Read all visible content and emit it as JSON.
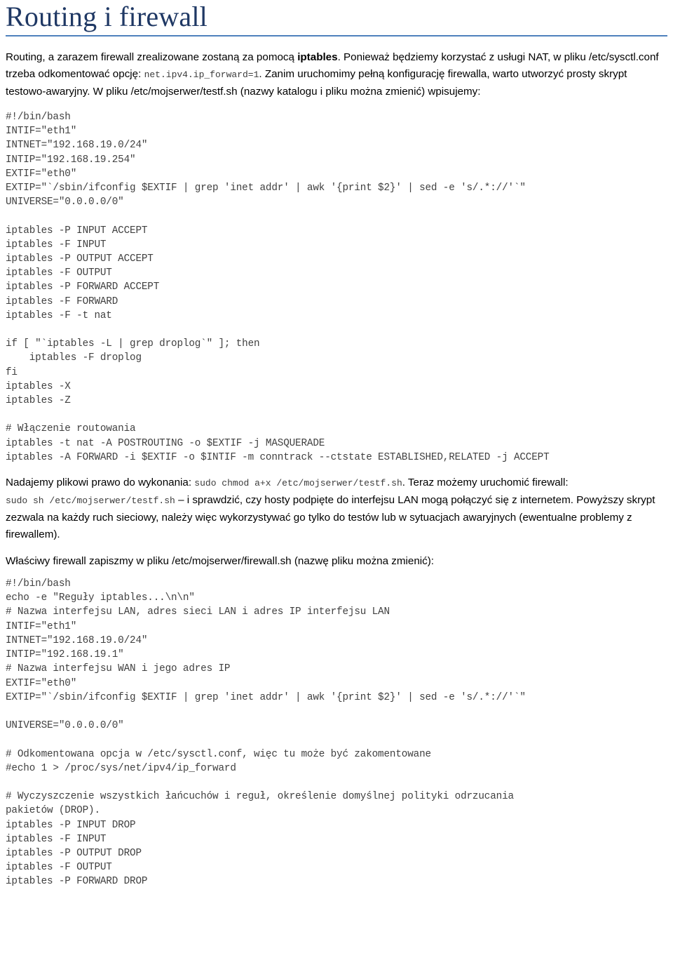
{
  "document": {
    "title": "Routing i firewall",
    "accent_color": "#1F3864",
    "rule_color": "#4F81BD"
  },
  "intro": {
    "part1": "Routing, a zarazem firewall zrealizowane zostaną za pomocą ",
    "bold1": "iptables",
    "part2": ". Ponieważ będziemy korzystać z usługi NAT, w pliku /etc/sysctl.conf trzeba odkomentować opcję: ",
    "code1": "net.ipv4.ip_forward=1",
    "part3": ". Zanim uruchomimy pełną konfigurację firewalla, warto utworzyć prosty skrypt testowo-awaryjny. W pliku /etc/mojserwer/testf.sh (nazwy katalogu i pliku można zmienić) wpisujemy:"
  },
  "code_block_1": "#!/bin/bash\nINTIF=\"eth1\"\nINTNET=\"192.168.19.0/24\"\nINTIP=\"192.168.19.254\"\nEXTIF=\"eth0\"\nEXTIP=\"`/sbin/ifconfig $EXTIF | grep 'inet addr' | awk '{print $2}' | sed -e 's/.*://'`\"\nUNIVERSE=\"0.0.0.0/0\"\n\niptables -P INPUT ACCEPT\niptables -F INPUT\niptables -P OUTPUT ACCEPT\niptables -F OUTPUT\niptables -P FORWARD ACCEPT\niptables -F FORWARD\niptables -F -t nat\n\nif [ \"`iptables -L | grep droplog`\" ]; then\n    iptables -F droplog\nfi\niptables -X\niptables -Z\n\n# Włączenie routowania\niptables -t nat -A POSTROUTING -o $EXTIF -j MASQUERADE\niptables -A FORWARD -i $EXTIF -o $INTIF -m conntrack --ctstate ESTABLISHED,RELATED -j ACCEPT",
  "para_exec": {
    "part1": "Nadajemy plikowi prawo do wykonania: ",
    "code1": "sudo chmod a+x /etc/mojserwer/testf.sh",
    "part2": ". Teraz możemy uruchomić firewall: ",
    "code2": "sudo sh /etc/mojserwer/testf.sh",
    "part3": " – i sprawdzić, czy hosty podpięte do interfejsu LAN mogą połączyć się z internetem. Powyższy skrypt zezwala na każdy ruch sieciowy, należy więc wykorzystywać go tylko do testów lub w sytuacjach awaryjnych (ewentualne problemy z firewallem)."
  },
  "para_firewall_intro": "Właściwy firewall zapiszmy w pliku /etc/mojserwer/firewall.sh (nazwę pliku można zmienić):",
  "code_block_2": "#!/bin/bash\necho -e \"Reguły iptables...\\n\\n\"\n# Nazwa interfejsu LAN, adres sieci LAN i adres IP interfejsu LAN\nINTIF=\"eth1\"\nINTNET=\"192.168.19.0/24\"\nINTIP=\"192.168.19.1\"\n# Nazwa interfejsu WAN i jego adres IP\nEXTIF=\"eth0\"\nEXTIP=\"`/sbin/ifconfig $EXTIF | grep 'inet addr' | awk '{print $2}' | sed -e 's/.*://'`\"\n\nUNIVERSE=\"0.0.0.0/0\"\n\n# Odkomentowana opcja w /etc/sysctl.conf, więc tu może być zakomentowane\n#echo 1 > /proc/sys/net/ipv4/ip_forward\n\n# Wyczyszczenie wszystkich łańcuchów i reguł, określenie domyślnej polityki odrzucania\npakietów (DROP).\niptables -P INPUT DROP\niptables -F INPUT\niptables -P OUTPUT DROP\niptables -F OUTPUT\niptables -P FORWARD DROP"
}
